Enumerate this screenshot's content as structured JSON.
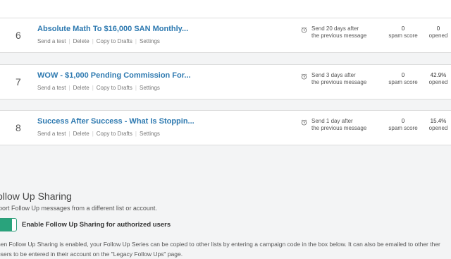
{
  "rows": [
    {
      "number": "6",
      "subject": "Absolute Math To $16,000 SAN Monthly...",
      "actions": [
        "Send a test",
        "Delete",
        "Copy to Drafts",
        "Settings"
      ],
      "timing_line1": "Send 20 days after",
      "timing_line2": "the previous message",
      "spam_value": "0",
      "spam_label": "spam score",
      "opened_value": "0",
      "opened_label": "opened"
    },
    {
      "number": "7",
      "subject": "WOW - $1,000 Pending Commission For...",
      "actions": [
        "Send a test",
        "Delete",
        "Copy to Drafts",
        "Settings"
      ],
      "timing_line1": "Send 3 days after",
      "timing_line2": "the previous message",
      "spam_value": "0",
      "spam_label": "spam score",
      "opened_value": "42.9%",
      "opened_label": "opened"
    },
    {
      "number": "8",
      "subject": "Success After Success - What Is Stoppin...",
      "actions": [
        "Send a test",
        "Delete",
        "Copy to Drafts",
        "Settings"
      ],
      "timing_line1": "Send 1 day after",
      "timing_line2": "the previous message",
      "spam_value": "0",
      "spam_label": "spam score",
      "opened_value": "15.4%",
      "opened_label": "opened"
    }
  ],
  "sharing": {
    "title": "ollow Up Sharing",
    "subtitle": "port Follow Up messages from a different list or account.",
    "toggle_label": "Enable Follow Up Sharing for authorized users",
    "toggle_on": true,
    "description": "hen Follow Up Sharing is enabled, your Follow Up Series can be copied to other lists by entering a campaign code in the box below. It can also be emailed to other ther users to be entered in their account on the \"Legacy Follow Ups\" page."
  },
  "colors": {
    "link": "#2d79b0",
    "toggle_green": "#29a37c",
    "section_bg": "#f3f4f5"
  }
}
